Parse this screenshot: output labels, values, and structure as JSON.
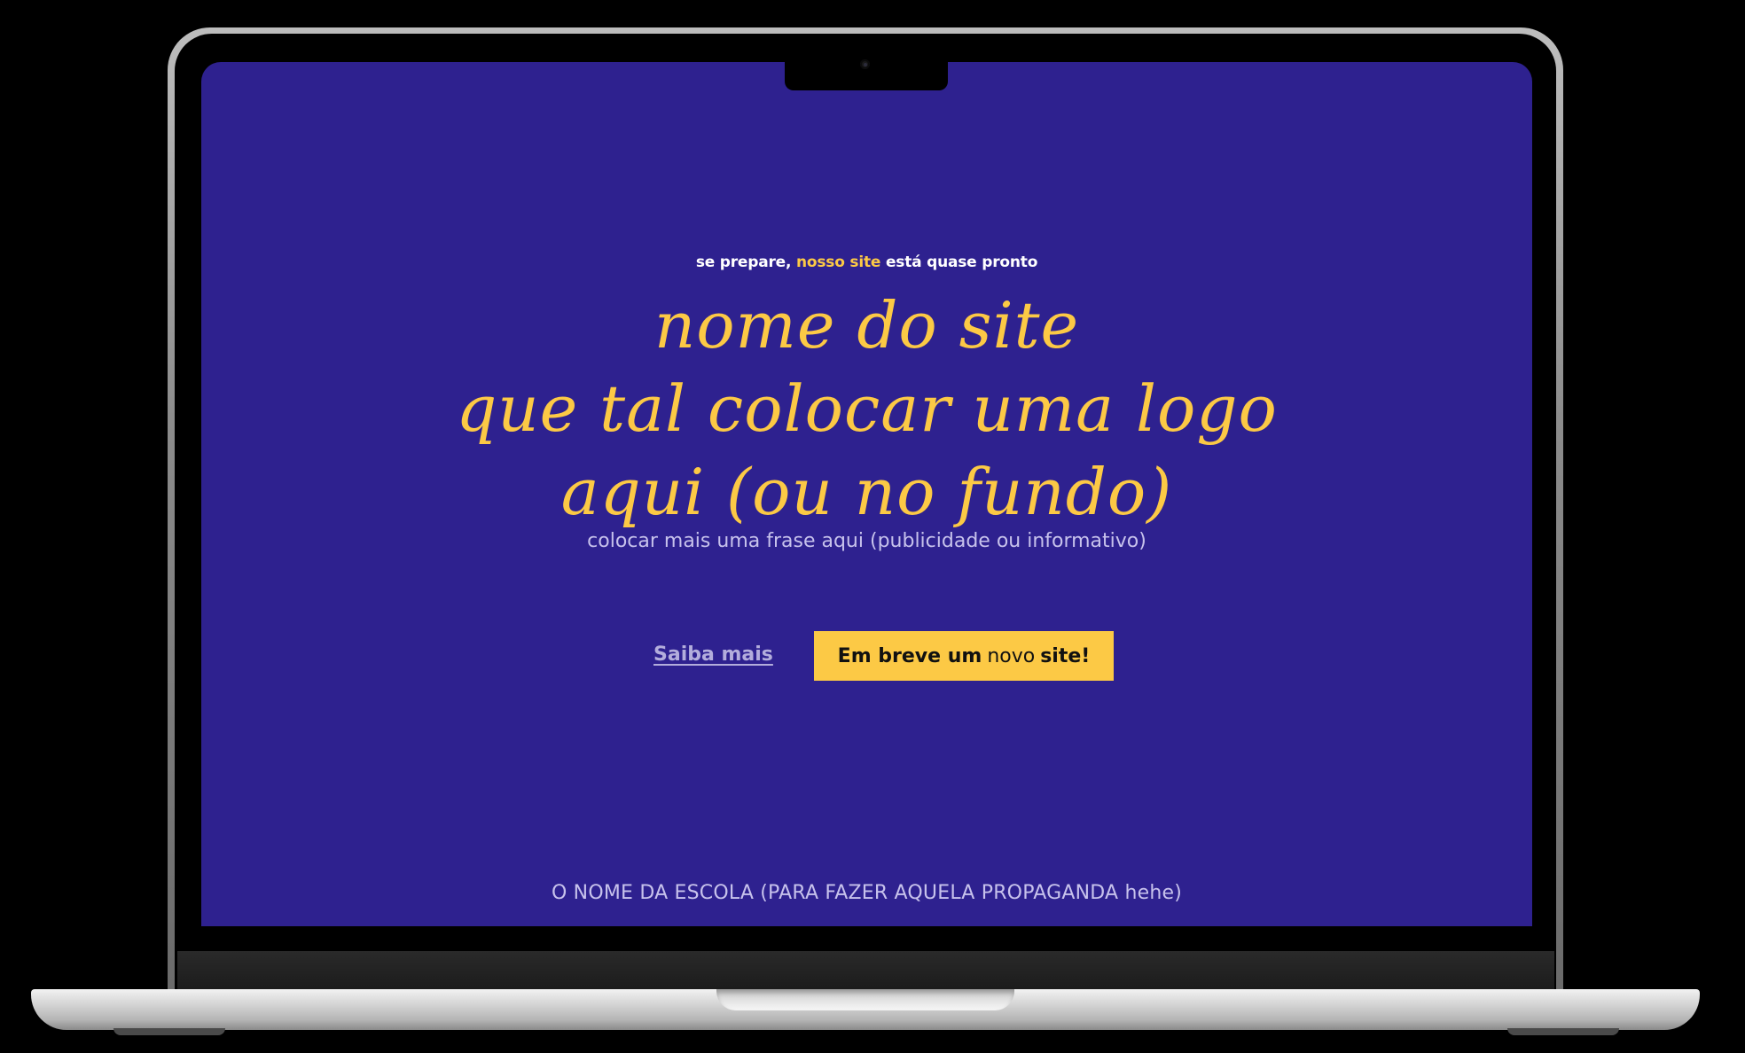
{
  "colors": {
    "screen_background": "#2e218f",
    "accent_yellow": "#fcc945",
    "muted_text": "#c7c2ec",
    "link_text": "#b3addc"
  },
  "hero": {
    "teaser_prefix": "se prepare,",
    "teaser_highlight": "nosso site",
    "teaser_suffix": "está quase pronto",
    "headline_line1": "nome do site",
    "headline_line2": "que tal colocar uma logo",
    "headline_line3": "aqui (ou no fundo)",
    "subline": "colocar mais uma frase aqui (publicidade ou informativo)"
  },
  "actions": {
    "more_link": "Saiba mais",
    "cta_part1": "Em breve um",
    "cta_part2": "novo",
    "cta_part3": "site!"
  },
  "footer": {
    "text": "O NOME DA ESCOLA (PARA FAZER AQUELA PROPAGANDA hehe)"
  },
  "device": {
    "camera_icon": "camera-icon"
  }
}
